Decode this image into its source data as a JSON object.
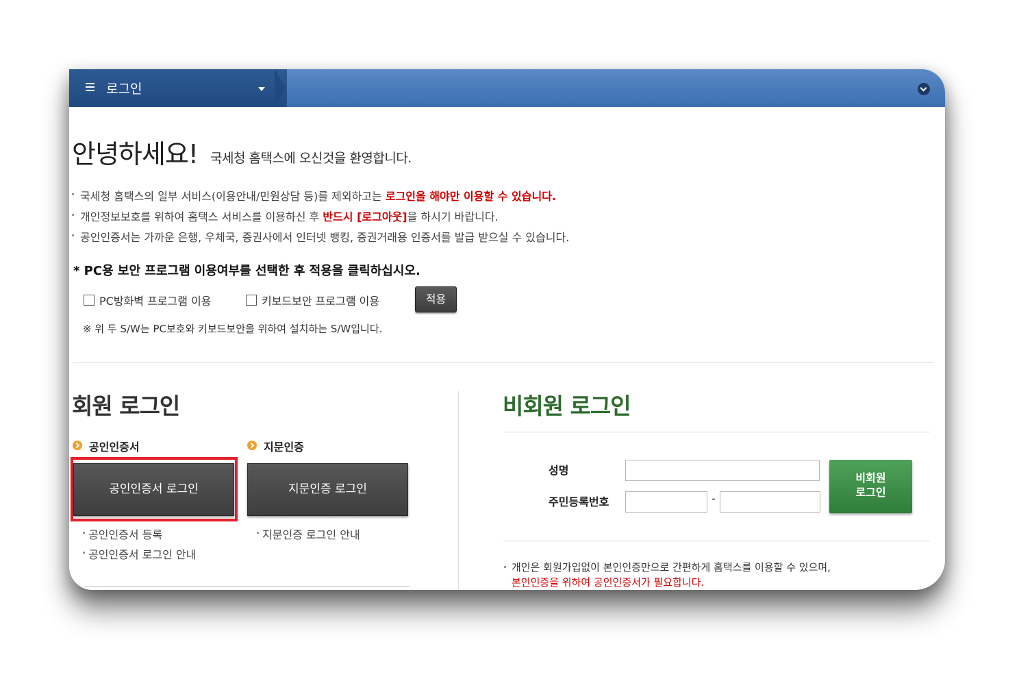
{
  "header": {
    "tab_title": "로그인",
    "menu_icon": "hamburger-menu-icon",
    "collapse_icon": "chevron-down-circle-icon",
    "colors": {
      "bar": "#3b6fb0",
      "tab": "#1f4a80"
    }
  },
  "greeting": {
    "big": "안녕하세요!",
    "small": "국세청 홈택스에 오신것을 환영합니다."
  },
  "notices": [
    {
      "text": "국세청 홈택스의 일부 서비스(이용안내/민원상담 등)를 제외하고는 ",
      "highlight": "로그인을 해야만 이용할 수 있습니다.",
      "after": ""
    },
    {
      "text": "개인정보보호를 위하여 홈택스 서비스를 이용하신 후 ",
      "highlight": "반드시 [로그아웃]",
      "after": "을 하시기 바랍니다."
    },
    {
      "text": "공인인증서는 가까운 은행, 우체국, 증권사에서 인터넷 뱅킹, 증권거래용 인증서를 발급 받으실 수 있습니다.",
      "highlight": "",
      "after": ""
    }
  ],
  "security": {
    "title": "* PC용 보안 프로그램 이용여부를 선택한 후 적용을 클릭하십시오.",
    "firewall_label": "PC방화벽 프로그램 이용",
    "keyboard_label": "키보드보안 프로그램 이용",
    "apply_label": "적용",
    "note": "※ 위 두 S/W는 PC보호와 키보드보안을 위하여 설치하는 S/W입니다."
  },
  "member": {
    "title": "회원 로그인",
    "cert_head": "공인인증서",
    "finger_head": "지문인증",
    "cert_button": "공인인증서 로그인",
    "finger_button": "지문인증 로그인",
    "cert_links": [
      "공인인증서 등록",
      "공인인증서 로그인 안내"
    ],
    "finger_links": [
      "지문인증 로그인 안내"
    ],
    "highlight_color": "#e5202b"
  },
  "nonmember": {
    "title": "비회원 로그인",
    "name_label": "성명",
    "rrn_label": "주민등록번호",
    "rrn_dash": "-",
    "button": "비회원 로그인",
    "button_line1": "비회원",
    "button_line2": "로그인",
    "note1": "개인은 회원가입없이 본인인증만으로 간편하게 홈택스를 이용할 수 있으며,",
    "note2": "본인인증을 위하여 공인인증서가 필요합니다.",
    "colors": {
      "title": "#2e6b2e",
      "button": "#2f7d3a"
    }
  }
}
